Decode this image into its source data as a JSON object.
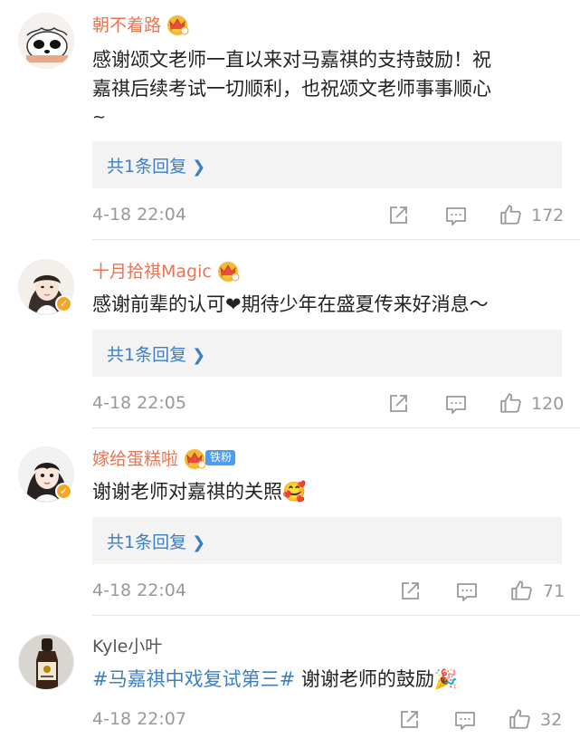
{
  "comments": [
    {
      "username": "朝不着路",
      "text_lines": [
        "感谢颂文老师一直以来对马嘉祺的支持鼓励！祝",
        "嘉祺后续考试一切顺利，也祝颂文老师事事顺心",
        "~"
      ],
      "reply_label": "共1条回复",
      "time": "4-18 22:04",
      "likes": "172"
    },
    {
      "username": "十月拾祺Magic",
      "text_lines": [
        "感谢前辈的认可❤期待少年在盛夏传来好消息～"
      ],
      "reply_label": "共1条回复",
      "time": "4-18 22:05",
      "likes": "120"
    },
    {
      "username": "嫁给蛋糕啦",
      "fan_badge": "铁粉",
      "text_lines": [
        "谢谢老师对嘉祺的关照🥰"
      ],
      "reply_label": "共1条回复",
      "time": "4-18 22:04",
      "likes": "71"
    },
    {
      "username": "Kyle小叶",
      "hashtag": "#马嘉祺中戏复试第三#",
      "text_after_hashtag": " 谢谢老师的鼓励🎉",
      "time": "4-18 22:07",
      "likes": "32"
    }
  ],
  "icons": {
    "share": "share-icon",
    "comment": "comment-icon",
    "like": "thumbs-up-icon",
    "crown": "crown-icon",
    "verified": "verified-badge-icon"
  },
  "colors": {
    "username_member": "#eb7350",
    "link": "#3d7fc2",
    "meta": "#999999",
    "reply_bg": "#f3f3f3",
    "badge": "#f5a623"
  }
}
